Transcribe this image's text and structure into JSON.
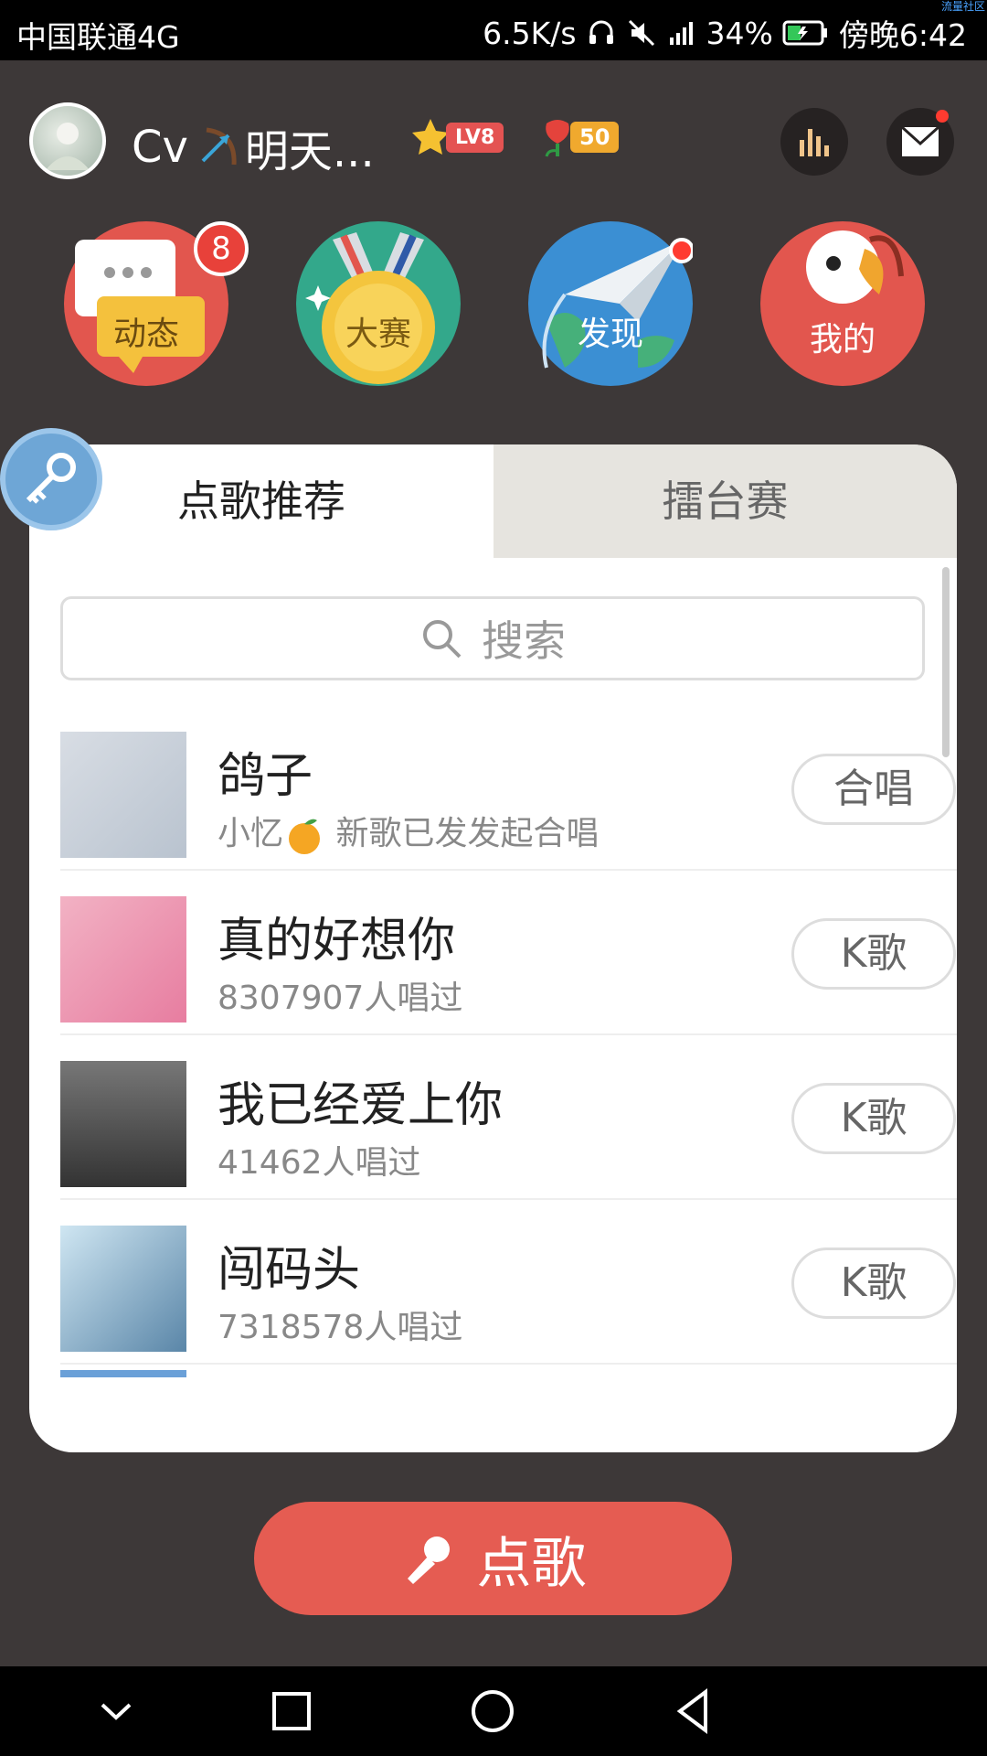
{
  "status_bar": {
    "carrier": "中国联通4G",
    "speed": "6.5K/s",
    "battery": "34%",
    "time": "傍晚6:42",
    "watermark": "流量社区"
  },
  "header": {
    "username": "Cv",
    "username_suffix": "明天...",
    "level_badge": "LV8",
    "flower_count": "50",
    "icons": [
      "avatar",
      "bow-arrow-icon",
      "star-icon",
      "flower-icon",
      "stats-icon",
      "mail-icon"
    ]
  },
  "nav": {
    "items": [
      {
        "label": "动态",
        "badge": "8"
      },
      {
        "label": "大赛"
      },
      {
        "label": "发现"
      },
      {
        "label": "我的"
      }
    ]
  },
  "tabs": {
    "active": "点歌推荐",
    "inactive": "擂台赛"
  },
  "search": {
    "placeholder": "搜索"
  },
  "songs": [
    {
      "title": "鸽子",
      "subtitle_prefix": "小忆",
      "subtitle_suffix": "新歌已发发起合唱",
      "action": "合唱"
    },
    {
      "title": "真的好想你",
      "subtitle": "8307907人唱过",
      "action": "K歌"
    },
    {
      "title": "我已经爱上你",
      "subtitle": "41462人唱过",
      "action": "K歌"
    },
    {
      "title": "闯码头",
      "subtitle": "7318578人唱过",
      "action": "K歌"
    }
  ],
  "primary_button": {
    "label": "点歌"
  },
  "colors": {
    "background": "#3d3838",
    "accent_red": "#e55c52",
    "tab_inactive": "#e6e4df"
  }
}
